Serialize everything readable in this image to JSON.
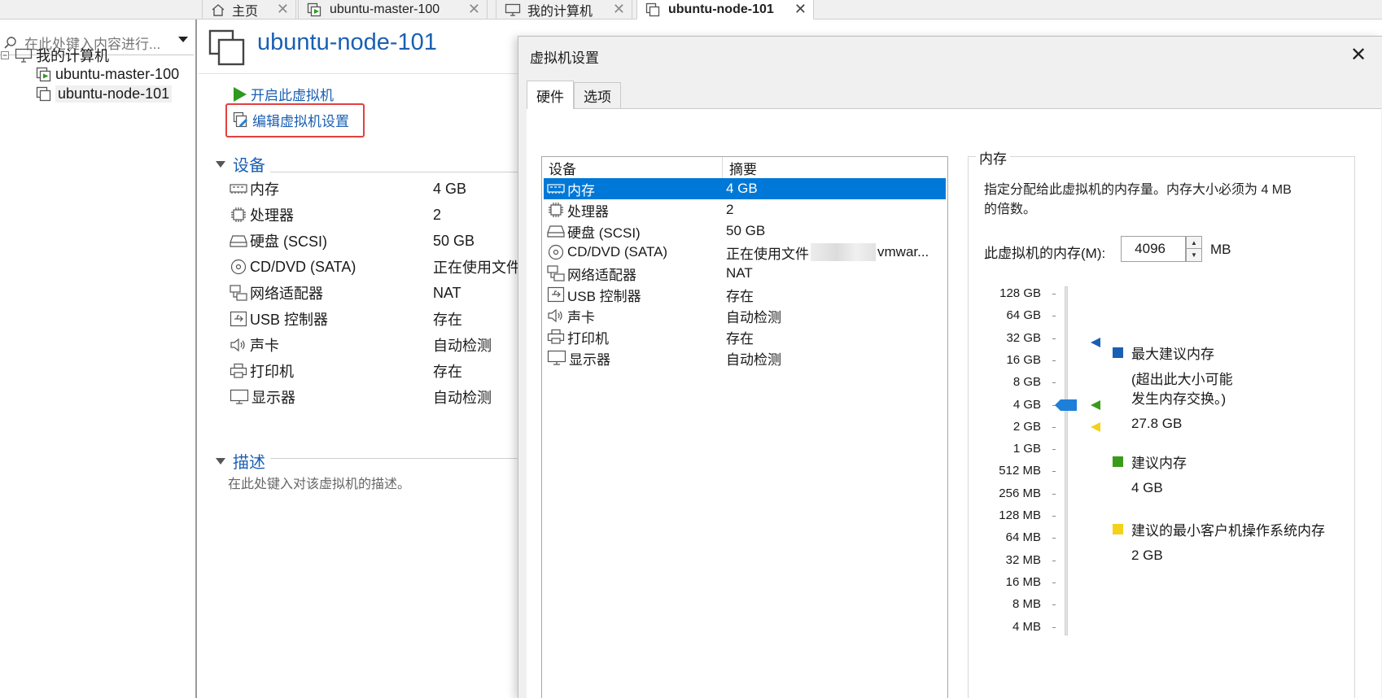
{
  "tabs": [
    {
      "label": "主页",
      "icon": "home-icon",
      "active": false
    },
    {
      "label": "ubuntu-master-100",
      "icon": "vm-running-icon",
      "active": false
    },
    {
      "label": "我的计算机",
      "icon": "monitor-icon",
      "active": false
    },
    {
      "label": "ubuntu-node-101",
      "icon": "vm-icon",
      "active": true
    }
  ],
  "library": {
    "search_placeholder": "在此处键入内容进行...",
    "root_label": "我的计算机",
    "items": [
      "ubuntu-master-100",
      "ubuntu-node-101"
    ]
  },
  "vm": {
    "title": "ubuntu-node-101",
    "power_on": "开启此虚拟机",
    "edit_settings": "编辑虚拟机设置",
    "devices_section": "设备",
    "devices": [
      {
        "name": "内存",
        "value": "4 GB",
        "icon": "memory-icon"
      },
      {
        "name": "处理器",
        "value": "2",
        "icon": "cpu-icon"
      },
      {
        "name": "硬盘 (SCSI)",
        "value": "50 GB",
        "icon": "disk-icon"
      },
      {
        "name": "CD/DVD (SATA)",
        "value": "正在使用文件",
        "icon": "cd-icon"
      },
      {
        "name": "网络适配器",
        "value": "NAT",
        "icon": "network-icon"
      },
      {
        "name": "USB 控制器",
        "value": "存在",
        "icon": "usb-icon"
      },
      {
        "name": "声卡",
        "value": "自动检测",
        "icon": "speaker-icon"
      },
      {
        "name": "打印机",
        "value": "存在",
        "icon": "printer-icon"
      },
      {
        "name": "显示器",
        "value": "自动检测",
        "icon": "display-icon"
      }
    ],
    "description_section": "描述",
    "description_placeholder": "在此处键入对该虚拟机的描述。"
  },
  "dialog": {
    "title": "虚拟机设置",
    "close": "✕",
    "tabs": [
      "硬件",
      "选项"
    ],
    "columns": [
      "设备",
      "摘要"
    ],
    "devices": [
      {
        "name": "内存",
        "summary": "4 GB",
        "icon": "memory-icon",
        "selected": true
      },
      {
        "name": "处理器",
        "summary": "2",
        "icon": "cpu-icon"
      },
      {
        "name": "硬盘 (SCSI)",
        "summary": "50 GB",
        "icon": "disk-icon"
      },
      {
        "name": "CD/DVD (SATA)",
        "summary": "正在使用文件",
        "summary_tail": "vmwar...",
        "icon": "cd-icon"
      },
      {
        "name": "网络适配器",
        "summary": "NAT",
        "icon": "network-icon"
      },
      {
        "name": "USB 控制器",
        "summary": "存在",
        "icon": "usb-icon"
      },
      {
        "name": "声卡",
        "summary": "自动检测",
        "icon": "speaker-icon"
      },
      {
        "name": "打印机",
        "summary": "存在",
        "icon": "printer-icon"
      },
      {
        "name": "显示器",
        "summary": "自动检测",
        "icon": "display-icon"
      }
    ],
    "memory": {
      "group_title": "内存",
      "description_line1": "指定分配给此虚拟机的内存量。内存大小必须为 4 MB",
      "description_line2": "的倍数。",
      "field_label": "此虚拟机的内存(M):",
      "value": "4096",
      "unit": "MB",
      "scale": [
        "128 GB",
        "64 GB",
        "32 GB",
        "16 GB",
        "8 GB",
        "4 GB",
        "2 GB",
        "1 GB",
        "512 MB",
        "256 MB",
        "128 MB",
        "64 MB",
        "32 MB",
        "16 MB",
        "8 MB",
        "4 MB"
      ],
      "current_mb": 4096,
      "max_recommended_mb": 28467,
      "recommended_mb": 4096,
      "min_guest_mb": 2048,
      "legend": {
        "max_title": "最大建议内存",
        "max_note1": "(超出此大小可能",
        "max_note2": "发生内存交换。)",
        "max_value": "27.8 GB",
        "rec_title": "建议内存",
        "rec_value": "4 GB",
        "min_title": "建议的最小客户机操作系统内存",
        "min_value": "2 GB"
      },
      "colors": {
        "max": "#1a5fb4",
        "rec": "#3a9b1a",
        "min": "#f2d21b",
        "slider": "#1e7fd8"
      }
    }
  }
}
